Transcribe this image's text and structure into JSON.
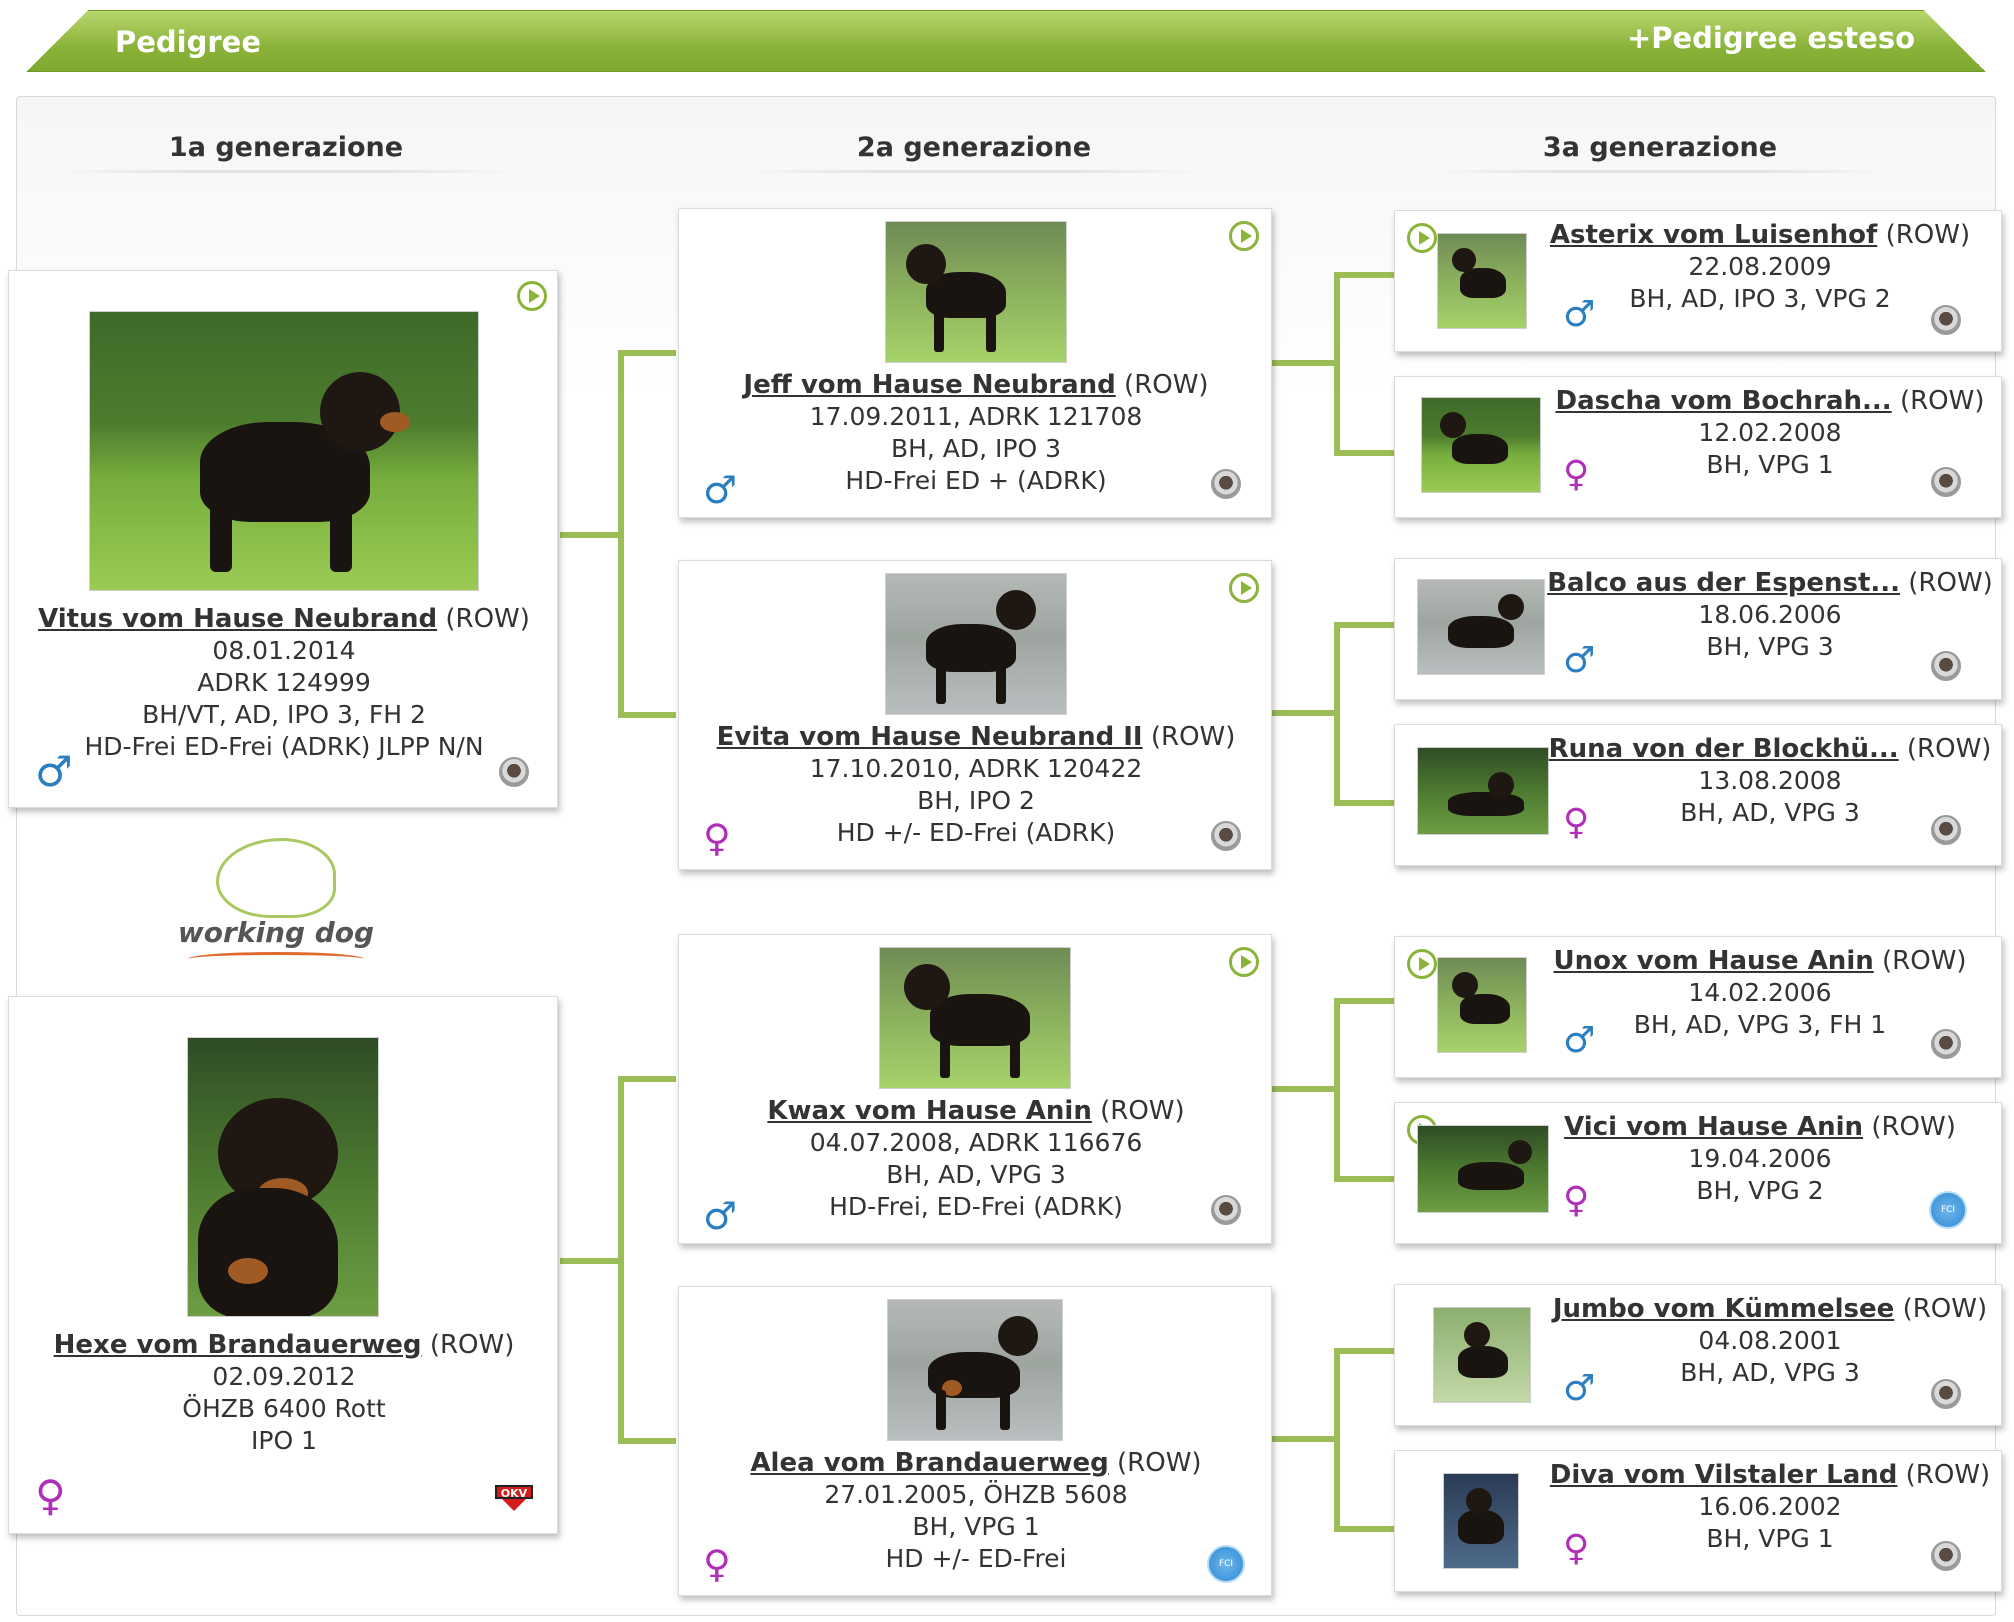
{
  "header": {
    "title": "Pedigree",
    "extended_link": "+Pedigree esteso"
  },
  "generations": [
    "1a generazione",
    "2a generazione",
    "3a generazione"
  ],
  "logo": {
    "text": "working dog"
  },
  "colors": {
    "accent_green": "#8bb33a",
    "male": "#2b7ec0",
    "female": "#b02fb8",
    "connector": "#9bbd55"
  },
  "gen1": [
    {
      "name": "Vitus vom Hause Neubrand",
      "breed": "(ROW)",
      "lines": [
        "08.01.2014",
        "ADRK 124999",
        "BH/VT, AD, IPO 3, FH 2",
        "HD-Frei ED-Frei (ADRK) JLPP N/N"
      ],
      "sex": "♂",
      "badge": "club-icon",
      "video": true
    },
    {
      "name": "Hexe vom Brandauerweg",
      "breed": "(ROW)",
      "lines": [
        "02.09.2012",
        "ÖHZB 6400 Rott",
        "IPO 1"
      ],
      "sex": "♀",
      "badge": "okv-icon",
      "badge_text": "OKV",
      "video": false
    }
  ],
  "gen2": [
    {
      "name": "Jeff vom Hause Neubrand",
      "breed": "(ROW)",
      "lines": [
        "17.09.2011, ADRK 121708",
        "BH, AD, IPO 3",
        "HD-Frei ED + (ADRK)"
      ],
      "sex": "♂",
      "badge": "club-icon",
      "video": true
    },
    {
      "name": "Evita vom Hause Neubrand II",
      "breed": "(ROW)",
      "lines": [
        "17.10.2010, ADRK 120422",
        "BH, IPO 2",
        "HD +/- ED-Frei (ADRK)"
      ],
      "sex": "♀",
      "badge": "club-icon",
      "video": true
    },
    {
      "name": "Kwax vom Hause Anin",
      "breed": "(ROW)",
      "lines": [
        "04.07.2008, ADRK 116676",
        "BH, AD, VPG 3",
        "HD-Frei, ED-Frei (ADRK)"
      ],
      "sex": "♂",
      "badge": "club-icon",
      "video": true
    },
    {
      "name": "Alea vom Brandauerweg",
      "breed": "(ROW)",
      "lines": [
        "27.01.2005, ÖHZB 5608",
        "BH, VPG 1",
        "HD +/- ED-Frei"
      ],
      "sex": "♀",
      "badge": "fci-icon",
      "badge_text": "FCI",
      "video": false
    }
  ],
  "gen3": [
    {
      "name": "Asterix vom Luisenhof",
      "breed": "(ROW)",
      "lines": [
        "22.08.2009",
        "BH, AD, IPO 3, VPG 2"
      ],
      "sex": "♂",
      "badge": "club-icon",
      "video": true
    },
    {
      "name": "Dascha vom Bochrah...",
      "breed": "(ROW)",
      "lines": [
        "12.02.2008",
        "BH, VPG 1"
      ],
      "sex": "♀",
      "badge": "club-icon",
      "video": false
    },
    {
      "name": "Balco aus der Espenst...",
      "breed": "(ROW)",
      "lines": [
        "18.06.2006",
        "BH, VPG 3"
      ],
      "sex": "♂",
      "badge": "club-icon",
      "video": false
    },
    {
      "name": "Runa von der Blockhü...",
      "breed": "(ROW)",
      "lines": [
        "13.08.2008",
        "BH, AD, VPG 3"
      ],
      "sex": "♀",
      "badge": "club-icon",
      "video": false
    },
    {
      "name": "Unox vom Hause Anin",
      "breed": "(ROW)",
      "lines": [
        "14.02.2006",
        "BH, AD, VPG 3, FH 1"
      ],
      "sex": "♂",
      "badge": "club-icon",
      "video": true
    },
    {
      "name": "Vici vom Hause Anin",
      "breed": "(ROW)",
      "lines": [
        "19.04.2006",
        "BH, VPG 2"
      ],
      "sex": "♀",
      "badge": "fci-icon",
      "badge_text": "FCI",
      "video": true
    },
    {
      "name": "Jumbo vom Kümmelsee",
      "breed": "(ROW)",
      "lines": [
        "04.08.2001",
        "BH, AD, VPG 3"
      ],
      "sex": "♂",
      "badge": "club-icon",
      "video": false
    },
    {
      "name": "Diva vom Vilstaler Land",
      "breed": "(ROW)",
      "lines": [
        "16.06.2002",
        "BH, VPG 1"
      ],
      "sex": "♀",
      "badge": "club-icon",
      "video": false
    }
  ]
}
